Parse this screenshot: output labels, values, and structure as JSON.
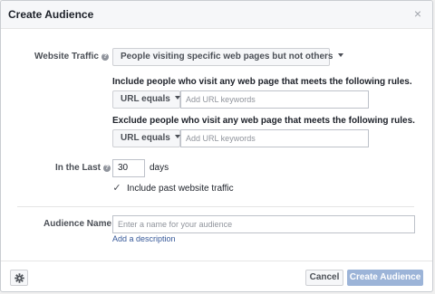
{
  "dialog": {
    "title": "Create Audience",
    "close_glyph": "×"
  },
  "website_traffic": {
    "label": "Website Traffic",
    "selected": "People visiting specific web pages but not others"
  },
  "include": {
    "text": "Include people who visit any web page that meets the following rules.",
    "operator": "URL equals",
    "placeholder": "Add URL keywords"
  },
  "exclude": {
    "text": "Exclude people who visit any web page that meets the following rules.",
    "operator": "URL equals",
    "placeholder": "Add URL keywords"
  },
  "in_the_last": {
    "label": "In the Last",
    "value": "30",
    "unit": "days"
  },
  "past_traffic": {
    "checked": true,
    "label": "Include past website traffic"
  },
  "audience_name": {
    "label": "Audience Name",
    "placeholder": "Enter a name for your audience",
    "add_description": "Add a description"
  },
  "footer": {
    "cancel_label": "Cancel",
    "create_label": "Create Audience"
  },
  "icons": {
    "help": "help-icon",
    "close": "close-icon",
    "gear": "gear-icon",
    "caret": "chevron-down-icon",
    "check": "checkmark-icon"
  },
  "colors": {
    "link": "#365899",
    "primary_disabled": "#9cb4d8"
  }
}
